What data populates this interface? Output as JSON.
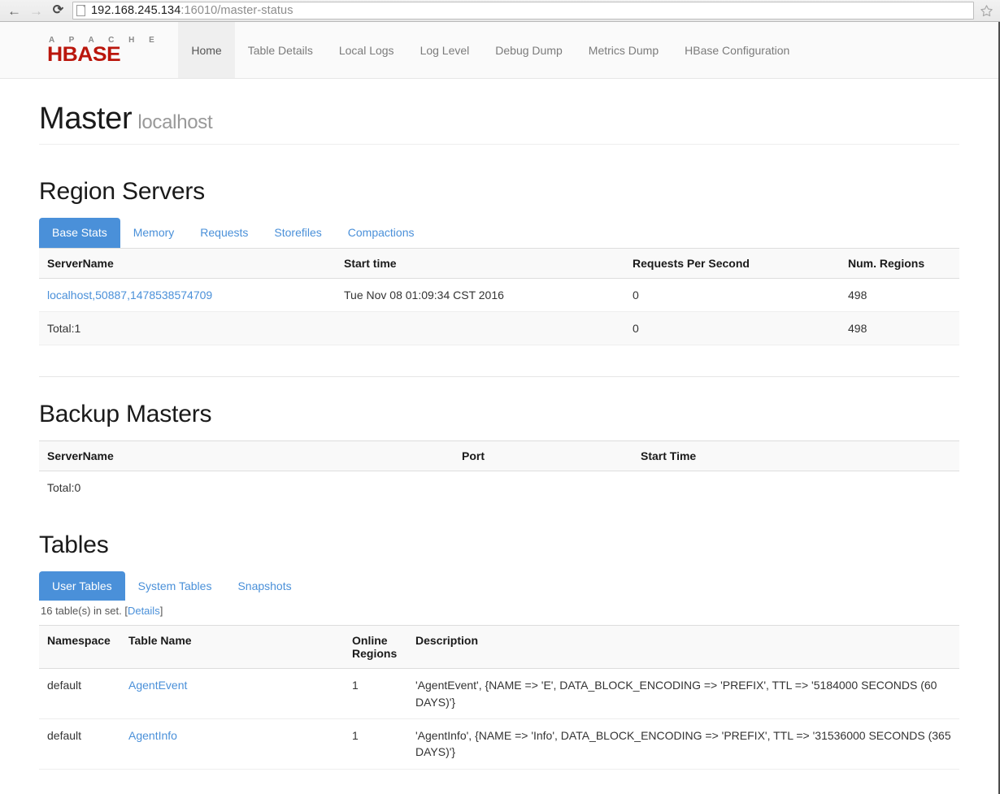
{
  "browser": {
    "back_icon": "back-arrow-icon",
    "forward_icon": "forward-arrow-icon",
    "reload_icon": "reload-icon",
    "reload_glyph": "⟳",
    "back_glyph": "←",
    "forward_glyph": "→",
    "url_host": "192.168.245.134",
    "url_rest": ":16010/master-status",
    "url_full": "192.168.245.134:16010/master-status",
    "bookmark_icon": "star-icon"
  },
  "navbar": {
    "brand_top": "A P A C H E",
    "brand_main": "HBASE",
    "links": [
      {
        "label": "Home",
        "active": true
      },
      {
        "label": "Table Details",
        "active": false
      },
      {
        "label": "Local Logs",
        "active": false
      },
      {
        "label": "Log Level",
        "active": false
      },
      {
        "label": "Debug Dump",
        "active": false
      },
      {
        "label": "Metrics Dump",
        "active": false
      },
      {
        "label": "HBase Configuration",
        "active": false
      }
    ]
  },
  "header": {
    "title": "Master",
    "subtitle": "localhost"
  },
  "region_servers": {
    "title": "Region Servers",
    "tabs": [
      {
        "label": "Base Stats",
        "active": true
      },
      {
        "label": "Memory",
        "active": false
      },
      {
        "label": "Requests",
        "active": false
      },
      {
        "label": "Storefiles",
        "active": false
      },
      {
        "label": "Compactions",
        "active": false
      }
    ],
    "columns": [
      "ServerName",
      "Start time",
      "Requests Per Second",
      "Num. Regions"
    ],
    "rows": [
      {
        "server_name": "localhost,50887,1478538574709",
        "start_time": "Tue Nov 08 01:09:34 CST 2016",
        "requests_per_second": "0",
        "num_regions": "498"
      }
    ],
    "total": {
      "label": "Total:1",
      "start_time": "",
      "requests_per_second": "0",
      "num_regions": "498"
    }
  },
  "backup_masters": {
    "title": "Backup Masters",
    "columns": [
      "ServerName",
      "Port",
      "Start Time"
    ],
    "rows": [],
    "total": {
      "label": "Total:0"
    }
  },
  "tables": {
    "title": "Tables",
    "tabs": [
      {
        "label": "User Tables",
        "active": true
      },
      {
        "label": "System Tables",
        "active": false
      },
      {
        "label": "Snapshots",
        "active": false
      }
    ],
    "meta_prefix": "16 table(s) in set. [",
    "meta_link": "Details",
    "meta_suffix": "]",
    "columns": [
      "Namespace",
      "Table Name",
      "Online Regions",
      "Description"
    ],
    "column_online_regions_line1": "Online",
    "column_online_regions_line2": "Regions",
    "rows": [
      {
        "namespace": "default",
        "table_name": "AgentEvent",
        "online_regions": "1",
        "description": "'AgentEvent', {NAME => 'E', DATA_BLOCK_ENCODING => 'PREFIX', TTL => '5184000 SECONDS (60 DAYS)'}"
      },
      {
        "namespace": "default",
        "table_name": "AgentInfo",
        "online_regions": "1",
        "description": "'AgentInfo', {NAME => 'Info', DATA_BLOCK_ENCODING => 'PREFIX', TTL => '31536000 SECONDS (365 DAYS)'}"
      }
    ]
  },
  "colors": {
    "accent": "#4a90d9",
    "brand_red": "#ba160c",
    "link": "#4a90d9",
    "muted": "#999999"
  }
}
